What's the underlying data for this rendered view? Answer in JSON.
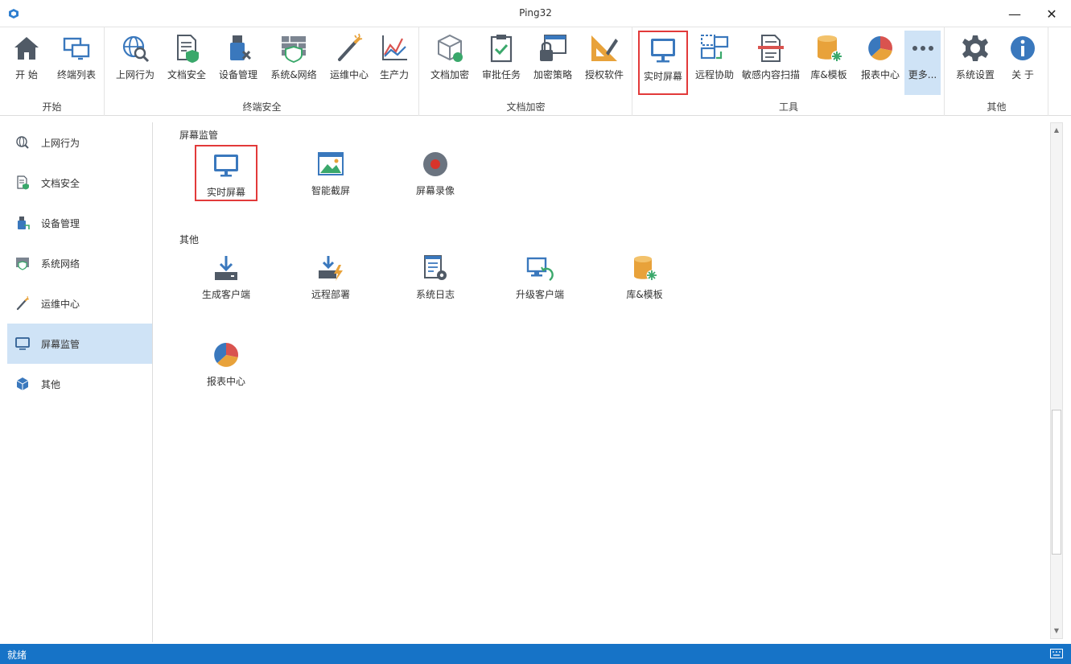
{
  "window": {
    "title": "Ping32",
    "minimize_glyph": "—",
    "close_glyph": "✕"
  },
  "ribbon": {
    "groups": [
      {
        "label": "开始",
        "items": [
          "开 始",
          "终端列表"
        ]
      },
      {
        "label": "终端安全",
        "items": [
          "上网行为",
          "文档安全",
          "设备管理",
          "系统&网络",
          "运维中心",
          "生产力"
        ]
      },
      {
        "label": "文档加密",
        "items": [
          "文档加密",
          "审批任务",
          "加密策略",
          "授权软件"
        ]
      },
      {
        "label": "工具",
        "items": [
          "实时屏幕",
          "远程协助",
          "敏感内容扫描",
          "库&模板",
          "报表中心",
          "更多..."
        ]
      },
      {
        "label": "其他",
        "items": [
          "系统设置",
          "关 于"
        ]
      }
    ]
  },
  "sidebar": {
    "items": [
      "上网行为",
      "文档安全",
      "设备管理",
      "系统网络",
      "运维中心",
      "屏幕监管",
      "其他"
    ],
    "selected": "屏幕监管"
  },
  "main": {
    "sections": [
      {
        "title": "屏幕监管",
        "tiles": [
          "实时屏幕",
          "智能截屏",
          "屏幕录像"
        ]
      },
      {
        "title": "其他",
        "tiles": [
          "生成客户端",
          "远程部署",
          "系统日志",
          "升级客户端",
          "库&模板",
          "报表中心"
        ]
      }
    ]
  },
  "status": {
    "text": "就绪"
  },
  "colors": {
    "accent": "#1673c7",
    "highlight": "#e23a3a",
    "selected_bg": "#cfe3f6",
    "icon_blue": "#3a78bd"
  },
  "icons": [
    "home-icon",
    "terminal-list-icon",
    "web-behavior-icon",
    "document-security-icon",
    "device-management-icon",
    "system-network-icon",
    "ops-center-icon",
    "productivity-icon",
    "document-encryption-icon",
    "approval-task-icon",
    "encryption-policy-icon",
    "authorized-software-icon",
    "realtime-screen-icon",
    "remote-assist-icon",
    "sensitive-scan-icon",
    "library-template-icon",
    "report-center-icon",
    "more-icon",
    "system-settings-icon",
    "about-icon"
  ]
}
